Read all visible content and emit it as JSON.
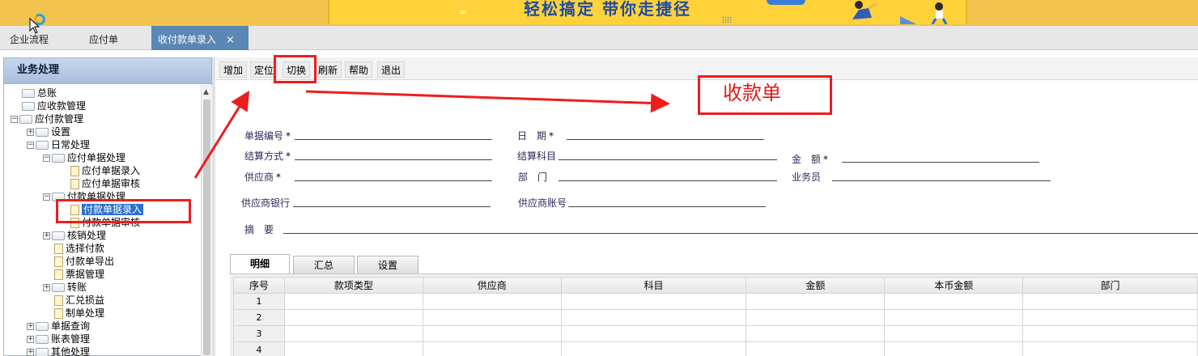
{
  "banner": {
    "slogan": "轻松搞定 带你走捷径",
    "dash": "="
  },
  "tabs": [
    {
      "label": "企业流程"
    },
    {
      "label": "应付单"
    },
    {
      "label": "收付款单录入",
      "active": true
    }
  ],
  "tab_close": "×",
  "sidebar": {
    "title": "业务处理",
    "tree": [
      {
        "label": "总账",
        "exp": "",
        "type": "folder"
      },
      {
        "label": "应收款管理",
        "exp": "",
        "type": "folder"
      },
      {
        "label": "应付款管理",
        "exp": "⊟",
        "type": "folder"
      },
      {
        "label": "设置",
        "exp": "⊞",
        "type": "folder"
      },
      {
        "label": "日常处理",
        "exp": "⊟",
        "type": "folder"
      },
      {
        "label": "应付单据处理",
        "exp": "⊟",
        "type": "folder"
      },
      {
        "label": "应付单据录入",
        "exp": "",
        "type": "doc"
      },
      {
        "label": "应付单据审核",
        "exp": "",
        "type": "doc"
      },
      {
        "label": "付款单据处理",
        "exp": "⊟",
        "type": "folder"
      },
      {
        "label": "付款单据录入",
        "exp": "",
        "type": "doc",
        "selected": true
      },
      {
        "label": "付款单据审核",
        "exp": "",
        "type": "doc"
      },
      {
        "label": "核销处理",
        "exp": "⊞",
        "type": "folder"
      },
      {
        "label": "选择付款",
        "exp": "",
        "type": "doc"
      },
      {
        "label": "付款单导出",
        "exp": "",
        "type": "doc"
      },
      {
        "label": "票据管理",
        "exp": "",
        "type": "doc"
      },
      {
        "label": "转账",
        "exp": "⊞",
        "type": "folder"
      },
      {
        "label": "汇兑损益",
        "exp": "",
        "type": "doc"
      },
      {
        "label": "制单处理",
        "exp": "",
        "type": "doc"
      },
      {
        "label": "单据查询",
        "exp": "⊞",
        "type": "folder"
      },
      {
        "label": "账表管理",
        "exp": "⊞",
        "type": "folder"
      },
      {
        "label": "其他处理",
        "exp": "⊞",
        "type": "folder"
      }
    ]
  },
  "toolbar": {
    "buttons": [
      "增加",
      "定位",
      "切换",
      "刷新",
      "帮助",
      "退出"
    ]
  },
  "form": {
    "bill_no": "单据编号",
    "date": "日　期",
    "settle_method": "结算方式",
    "settle_subject": "结算科目",
    "amount": "金　额",
    "supplier": "供应商",
    "dept": "部　门",
    "salesman": "业务员",
    "supplier_bank": "供应商银行",
    "supplier_account": "供应商账号",
    "memo": "摘　要",
    "required_mark": "*"
  },
  "annotation": {
    "label": "收款单",
    "color": "#ee1d1d"
  },
  "detail_tabs": [
    "明细",
    "汇总",
    "设置"
  ],
  "grid": {
    "columns": [
      "序号",
      "款项类型",
      "供应商",
      "科目",
      "金额",
      "本币金额",
      "部门"
    ],
    "rows": [
      "1",
      "2",
      "3",
      "4"
    ]
  }
}
